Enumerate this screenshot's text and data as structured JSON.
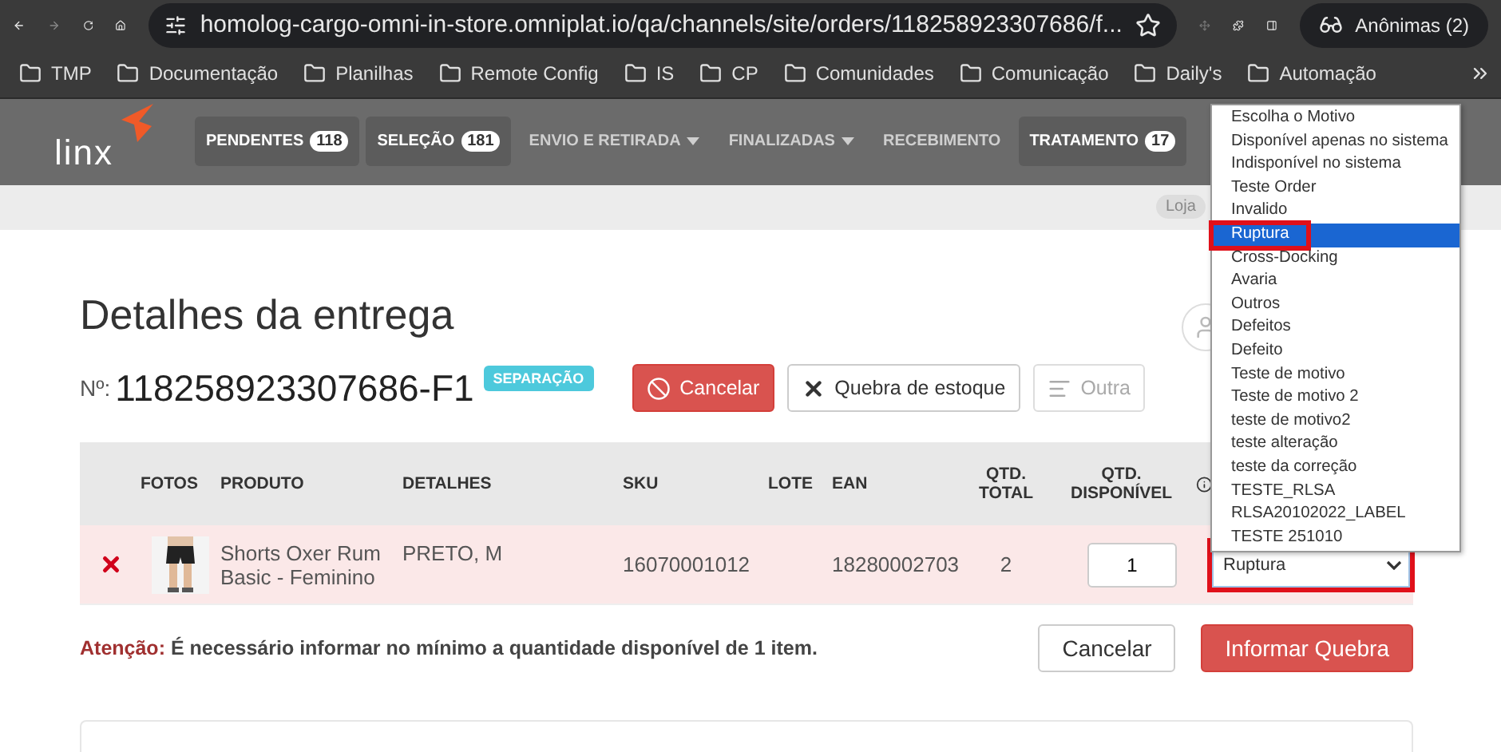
{
  "browser": {
    "url": "homolog-cargo-omni-in-store.omniplat.io/qa/channels/site/orders/118258923307686/f...",
    "profile": "Anônimas (2)",
    "bookmarks": [
      "TMP",
      "Documentação",
      "Planilhas",
      "Remote Config",
      "IS",
      "CP",
      "Comunidades",
      "Comunicação",
      "Daily's",
      "Automação"
    ]
  },
  "nav": {
    "logo": "linx",
    "items": [
      {
        "label": "PENDENTES",
        "count": "118",
        "selected": false,
        "kind": "badge"
      },
      {
        "label": "SELEÇÃO",
        "count": "181",
        "selected": false,
        "kind": "badge"
      },
      {
        "label": "ENVIO E RETIRADA",
        "kind": "dropdown"
      },
      {
        "label": "FINALIZADAS",
        "kind": "dropdown"
      },
      {
        "label": "RECEBIMENTO",
        "kind": "plain"
      },
      {
        "label": "TRATAMENTO",
        "count": "17",
        "selected": false,
        "kind": "badge"
      }
    ]
  },
  "store_chip": "Loja",
  "page": {
    "title": "Detalhes da entrega",
    "number_label": "Nº:",
    "number": "118258923307686-F1",
    "status": "SEPARAÇÃO",
    "actions": [
      {
        "label": "Cancelar",
        "kind": "danger"
      },
      {
        "label": "Quebra de estoque",
        "kind": "default"
      },
      {
        "label": "Outra",
        "kind": "muted"
      }
    ]
  },
  "table": {
    "columns": [
      "",
      "FOTOS",
      "PRODUTO",
      "DETALHES",
      "SKU",
      "LOTE",
      "EAN",
      "QTD. TOTAL",
      "QTD. DISPONÍVEL",
      ""
    ],
    "rows": [
      {
        "product": "Shorts Oxer Rum Basic - Feminino",
        "details": "PRETO, M",
        "sku": "16070001012",
        "lote": "",
        "ean": "18280002703",
        "total": "2",
        "available": "1",
        "reason": "Ruptura",
        "highlighted": true
      }
    ]
  },
  "warning": {
    "label": "Atenção:",
    "text": "É necessário informar no mínimo a quantidade disponível de 1 item."
  },
  "footer_buttons": [
    {
      "label": "Cancelar",
      "kind": "default"
    },
    {
      "label": "Informar Quebra",
      "kind": "danger"
    }
  ],
  "dropdown": {
    "options": [
      {
        "label": "Escolha o Motivo",
        "selected": false,
        "highlighted": false
      },
      {
        "label": "Disponível apenas no sistema",
        "selected": false,
        "highlighted": false
      },
      {
        "label": "Indisponível no sistema",
        "selected": false,
        "highlighted": false
      },
      {
        "label": "Teste Order",
        "selected": false,
        "highlighted": false
      },
      {
        "label": "Invalido",
        "selected": false,
        "highlighted": false
      },
      {
        "label": "Ruptura",
        "selected": true,
        "highlighted": true
      },
      {
        "label": "Cross-Docking",
        "selected": false,
        "highlighted": false
      },
      {
        "label": "Avaria",
        "selected": false,
        "highlighted": false
      },
      {
        "label": "Outros",
        "selected": false,
        "highlighted": false
      },
      {
        "label": "Defeitos",
        "selected": false,
        "highlighted": false
      },
      {
        "label": "Defeito",
        "selected": false,
        "highlighted": false
      },
      {
        "label": "Teste de motivo",
        "selected": false,
        "highlighted": false
      },
      {
        "label": "Teste de motivo 2",
        "selected": false,
        "highlighted": false
      },
      {
        "label": "teste de motivo2",
        "selected": false,
        "highlighted": false
      },
      {
        "label": "teste alteração",
        "selected": false,
        "highlighted": false
      },
      {
        "label": "teste da correção",
        "selected": false,
        "highlighted": false
      },
      {
        "label": "TESTE_RLSA",
        "selected": false,
        "highlighted": false
      },
      {
        "label": "RLSA20102022_LABEL",
        "selected": false,
        "highlighted": false
      },
      {
        "label": "TESTE 251010",
        "selected": false,
        "highlighted": false
      }
    ]
  }
}
